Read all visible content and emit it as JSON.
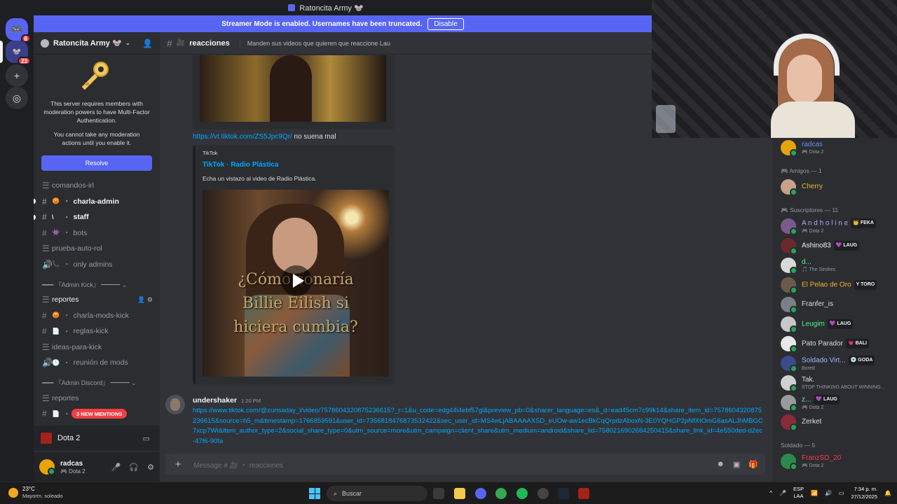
{
  "window": {
    "title": "Ratoncita Army 🐭"
  },
  "rail": {
    "dm_badge": "8",
    "server_badge": "23"
  },
  "banner": {
    "text": "Streamer Mode is enabled. Usernames have been truncated.",
    "disable_label": "Disable"
  },
  "server": {
    "name": "Ratoncita Army 🐭"
  },
  "mfa": {
    "line1": "This server requires members with moderation powers to have Multi-Factor Authentication.",
    "line2": "You cannot take any moderation actions until you enable it.",
    "resolve_label": "Resolve"
  },
  "channels": [
    {
      "type": "forum",
      "emoji": "",
      "name": "comandos-irl",
      "style": "muted"
    },
    {
      "type": "text",
      "emoji": "😡",
      "name": "charla-admin",
      "style": "bold",
      "unread": true
    },
    {
      "type": "text",
      "emoji": "\\",
      "name": "staff",
      "style": "bold",
      "unread": true
    },
    {
      "type": "text",
      "emoji": "👾",
      "name": "bots",
      "style": "muted"
    },
    {
      "type": "forum",
      "emoji": "",
      "name": "prueba-auto-rol",
      "style": "muted"
    },
    {
      "type": "voice",
      "emoji": "📞",
      "name": "only admins",
      "style": "muted"
    }
  ],
  "category_admin_kick": "━━━ 『Admin Kick』 ━━━ ⌄",
  "channels_kick": [
    {
      "type": "forum",
      "emoji": "",
      "name": "reportes",
      "style": "active"
    },
    {
      "type": "text",
      "emoji": "😡",
      "name": "charla-mods-kick",
      "style": "muted"
    },
    {
      "type": "text",
      "emoji": "📄",
      "name": "reglas-kick",
      "style": "muted"
    },
    {
      "type": "forum",
      "emoji": "",
      "name": "ideas-para-kick",
      "style": "muted"
    },
    {
      "type": "voice",
      "emoji": "🕒",
      "name": "reunión de mods",
      "style": "muted"
    }
  ],
  "category_admin_discord": "━━━ 『Admin Discord』 ━━━ ⌄",
  "channels_discord": [
    {
      "type": "forum",
      "emoji": "",
      "name": "reportes",
      "style": "muted"
    },
    {
      "type": "text",
      "emoji": "📄",
      "name": "",
      "style": "muted"
    }
  ],
  "mentions_pill": "3 NEW MENTIONS",
  "voice": {
    "label": "Dota 2"
  },
  "user": {
    "name": "radcas",
    "status": "🎮 Dota 2"
  },
  "chat": {
    "channel": "reacciones",
    "topic": "Manden sus videos que quieren que reaccione Lau",
    "link1": "https://vt.tiktok.com/ZS5Jpc9Qr/",
    "link1_text": " no suena mal",
    "embed": {
      "provider": "TikTok",
      "title": "TikTok · Radio Plástica",
      "description": "Echa un vistazo al video de Radio Plástica.",
      "video_text": "¿Cómo sonaría Billie Eilish si hiciera cumbia?"
    },
    "msg2": {
      "author": "undershaker",
      "time": "1:20 PM",
      "url": "https://www.tiktok.com/@zurisaday_l/video/7578604320875236615?_r=1&u_code=edg44i4ebf57gl&preview_pb=0&sharer_language=es&_d=ead45cm7c99k14&share_item_id=7578604320875236615&source=h5_m&timestamp=1766859591&user_id=7356818476873532422&sec_user_id=MS4wLjABAAAAXSD_eUOw-aw1ecBkCqQrpdzAboxN-3E0YQHGP2pNfXtOmG6asALJhMBGC7xcp7Wt&item_author_type=2&social_share_type=0&utm_source=more&utm_campaign=client_share&utm_medium=android&share_iid=7580216902684250415&share_link_id=4e550ded-d2ec-47f6-90fa"
    },
    "composer_placeholder": "Message # 🎥 ・ reacciones"
  },
  "members": {
    "top": [
      {
        "name": "radcas",
        "sub": "🎮 Dota 2",
        "color": "#5f8fff",
        "av": "#e5a50a"
      }
    ],
    "amigos_header": "🎮 Amigos — 1",
    "amigos": [
      {
        "name": "Cherry",
        "sub": "",
        "color": "#f0b232",
        "av": "#c9a08a"
      }
    ],
    "subs_header": "🎮 Suscriptores — 11",
    "subs": [
      {
        "name": "A n d h o l i n e",
        "tag": "👑 FEKA",
        "sub": "🎮 Dota 2",
        "color": "#b8a3f5",
        "av": "#7a5a8a"
      },
      {
        "name": "Ashino83",
        "tag": "💜 LAUG",
        "sub": "",
        "color": "#f2f3f5",
        "av": "#6a2a2a"
      },
      {
        "name": "d...",
        "tag": "",
        "sub": "🎵 The Strokes",
        "color": "#57f287",
        "av": "#d8d8d8"
      },
      {
        "name": "El Pelao de Oro",
        "tag": "Y TORO",
        "sub": "",
        "color": "#f0b232",
        "av": "#6a5a4a"
      },
      {
        "name": "Franfer_is",
        "tag": "",
        "sub": "",
        "color": "#dbdee1",
        "av": "#7a8088"
      },
      {
        "name": "Leugim",
        "tag": "💜 LAUG",
        "sub": "",
        "color": "#57f287",
        "av": "#c8c8c8"
      },
      {
        "name": "Pato Parador",
        "tag": "💗 BALI",
        "sub": "",
        "color": "#dbdee1",
        "av": "#e8e8e8"
      },
      {
        "name": "Soldado Virt...",
        "tag": "💿 GODA",
        "sub": "Bored",
        "color": "#9eb6ff",
        "av": "#3a4a8a"
      },
      {
        "name": "Tak.",
        "tag": "",
        "sub": "STOP THINKING ABOUT WINNING...",
        "color": "#dbdee1",
        "av": "#d0d0d0"
      },
      {
        "name": "z...",
        "tag": "💜 LAUG",
        "sub": "🎮 Dota 2",
        "color": "#57f287",
        "av": "#9a9a9a"
      },
      {
        "name": "Zerket",
        "tag": "",
        "sub": "",
        "color": "#dbdee1",
        "av": "#8a2a3a"
      }
    ],
    "soldado_header": "Soldado — 5",
    "soldado": [
      {
        "name": "FranzSD_20",
        "sub": "🎮 Dota 2",
        "color": "#f23f43",
        "av": "#2a8a4a"
      }
    ]
  },
  "taskbar": {
    "temp": "23°C",
    "condition": "Mayorm. soleado",
    "search": "Buscar",
    "lang1": "ESP",
    "lang2": "LAA",
    "time": "7:34 p. m.",
    "date": "27/12/2025"
  }
}
